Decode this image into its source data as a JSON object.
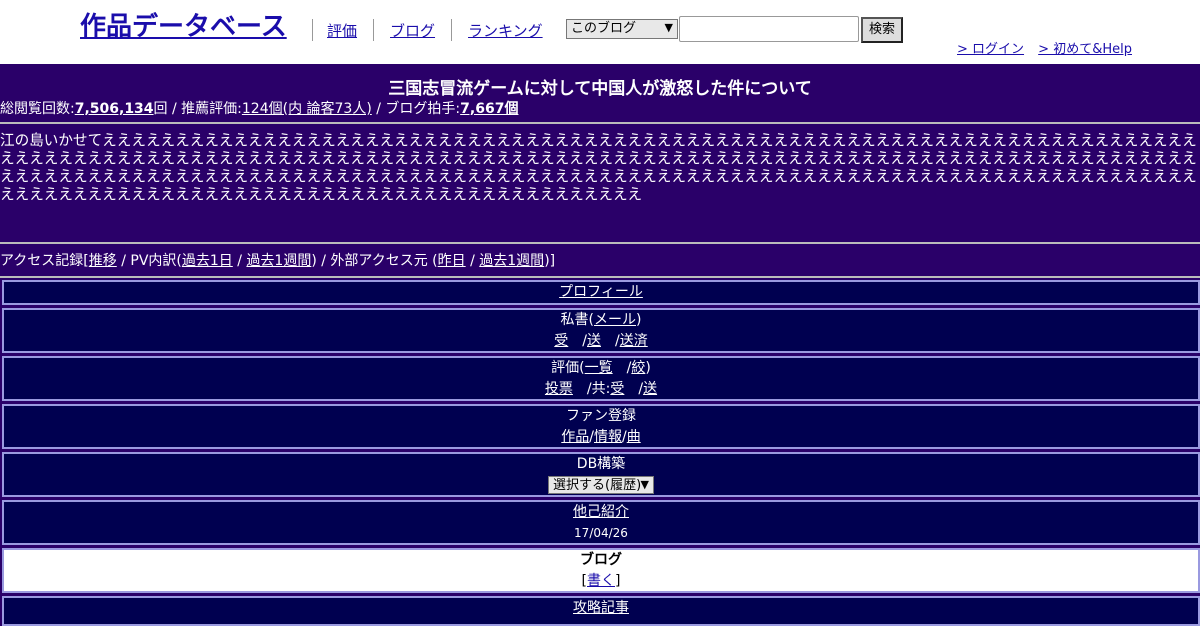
{
  "header": {
    "logo": "作品データベース",
    "nav": [
      "評価",
      "ブログ",
      "ランキング"
    ],
    "scope_select": "このブログ",
    "search_placeholder": "",
    "search_button": "検索",
    "login": "> ログイン",
    "help": "> 初めて&Help"
  },
  "blog": {
    "title": "三国志冒流ゲームに対して中国人が激怒した件について",
    "stats": {
      "views_label": "総閲覧回数:",
      "views": "7,506,134",
      "views_unit": "回 / 推薦評価:",
      "recommend": "124個(内 論客73人)",
      "clap_label": " / ブログ拍手:",
      "claps": "7,667個"
    },
    "description": "江の島いかせてえええええええええええええええええええええええええええええええええええええええええええええええええええええええええええええええええええええええええええええええええええええええええええええええええええええええええええええええええええええええええええええええええええええええええええええええええええええええええええええええええええええええええええええええええええええええええええええええええええええええええええええええええええええええええええええええええええええええええええええええええええええええええええええええええええええええええええええええええええええええええええ",
    "access": {
      "label": "アクセス記録[",
      "trend": "推移",
      "pv_label": " / PV内訳(",
      "pv_day": "過去1日",
      "slash1": " / ",
      "pv_week": "過去1週間",
      "ext_label": ") / 外部アクセス元 (",
      "ext_day": "昨日",
      "slash2": " / ",
      "ext_week": "過去1週間",
      "close": ")]"
    }
  },
  "menu": {
    "profile": "プロフィール",
    "mail_title": "私書(",
    "mail_link": "メール",
    "mail_close": ")",
    "mail_links": [
      "受",
      "送",
      "送済"
    ],
    "eval_title": "評価(",
    "eval_list": "一覧",
    "eval_filter": "絞",
    "eval_close": ")",
    "eval_vote": "投票",
    "eval_shared": "/共:",
    "eval_recv": "受",
    "eval_send": "送",
    "fan_title": "ファン登録",
    "fan_links": [
      "作品",
      "情報",
      "曲"
    ],
    "db_title": "DB構築",
    "db_select": "選択する(履歴)",
    "intro": "他己紹介",
    "intro_date": "17/04/26",
    "blog_title": "ブログ",
    "blog_write": "書く",
    "strategy": "攻略記事"
  },
  "colors": {
    "band": "#2a0069",
    "box": "#000050",
    "link": "#1a0dab"
  }
}
